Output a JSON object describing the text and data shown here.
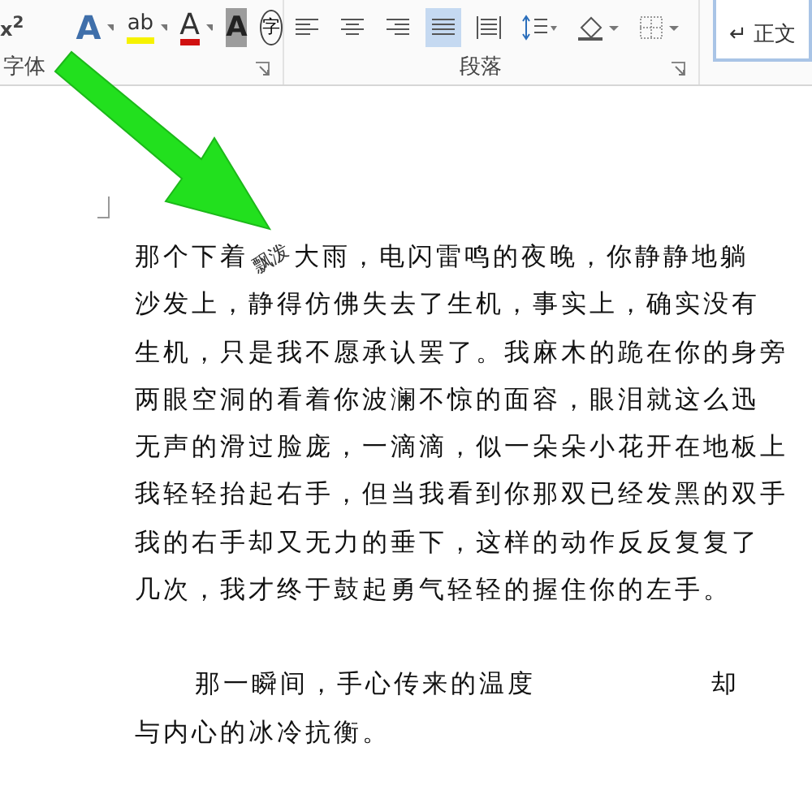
{
  "ribbon": {
    "font_group": {
      "label": "字体",
      "superscript": "x$^{2}$",
      "tools": [
        {
          "kind": "text-effect",
          "glyph": "A"
        },
        {
          "kind": "highlight",
          "glyph": "ab"
        },
        {
          "kind": "font-color",
          "glyph": "A"
        },
        {
          "kind": "shading",
          "glyph": "A"
        },
        {
          "kind": "enclose",
          "glyph": "字"
        }
      ]
    },
    "paragraph_group": {
      "label": "段落",
      "tools": [
        {
          "kind": "align-left",
          "selected": false
        },
        {
          "kind": "align-center",
          "selected": false
        },
        {
          "kind": "align-right",
          "selected": false
        },
        {
          "kind": "justify",
          "selected": true
        },
        {
          "kind": "distributed",
          "selected": false
        },
        {
          "kind": "line-spacing",
          "selected": false
        },
        {
          "kind": "fill",
          "selected": false
        },
        {
          "kind": "border",
          "selected": false
        }
      ]
    },
    "style_gallery": {
      "mark": "↵",
      "name": "正文"
    }
  },
  "document": {
    "paragraphs": [
      {
        "indent": false,
        "lines": [
          {
            "segments": [
              {
                "kind": "plain",
                "text": "那个下着"
              },
              {
                "kind": "rotated",
                "text": "飘泼"
              },
              {
                "kind": "plain",
                "text": "大雨，电闪雷鸣的夜晚，你静静地躺"
              }
            ]
          },
          {
            "segments": [
              {
                "kind": "plain",
                "text": "沙发上，静得仿佛失去了生机，事实上，确实没有"
              }
            ]
          },
          {
            "segments": [
              {
                "kind": "plain",
                "text": "生机，只是我不愿承认罢了。我麻木的跪在你的身旁"
              }
            ]
          },
          {
            "segments": [
              {
                "kind": "plain",
                "text": "两眼空洞的看着你波澜不惊的面容，眼泪就这么迅"
              }
            ]
          },
          {
            "segments": [
              {
                "kind": "plain",
                "text": "无声的滑过脸庞，一滴滴，似一朵朵小花开在地板上"
              }
            ]
          },
          {
            "segments": [
              {
                "kind": "plain",
                "text": "我轻轻抬起右手，但当我看到你那双已经发黑的双手"
              }
            ]
          },
          {
            "segments": [
              {
                "kind": "plain",
                "text": "我的右手却又无力的垂下，这样的动作反反复复了"
              }
            ]
          },
          {
            "segments": [
              {
                "kind": "plain",
                "text": "几次，我才终于鼓起勇气轻轻的握住你的左手。"
              }
            ]
          }
        ]
      },
      {
        "indent": true,
        "lines": [
          {
            "segments": [
              {
                "kind": "plain",
                "text": "那一瞬间，手心传来的温度"
              },
              {
                "kind": "gap",
                "text": "却"
              }
            ]
          },
          {
            "segments": [
              {
                "kind": "plain",
                "text": "与内心的冰冷抗衡。"
              }
            ]
          }
        ]
      }
    ]
  }
}
